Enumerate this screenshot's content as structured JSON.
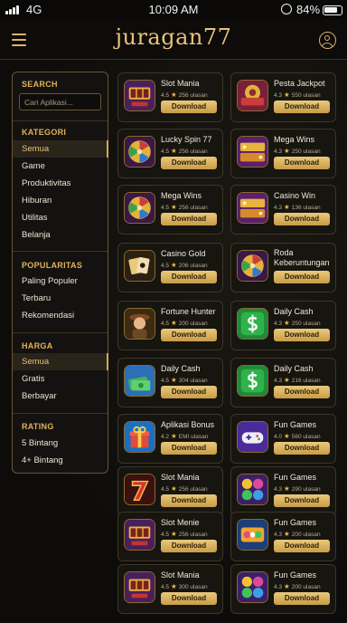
{
  "status_bar": {
    "network": "4G",
    "time": "10:09 AM",
    "battery": "84%"
  },
  "header": {
    "logo": "juragan77"
  },
  "sidebar": {
    "search": {
      "title": "SEARCH",
      "placeholder": "Cari Aplikasi..."
    },
    "kategori": {
      "title": "KATEGORI",
      "items": [
        "Semua",
        "Game",
        "Produktivitas",
        "Hiburan",
        "Utilitas",
        "Belanja"
      ],
      "active": 0
    },
    "popularitas": {
      "title": "POPULARITAS",
      "items": [
        "Paling Populer",
        "Terbaru",
        "Rekomendasi"
      ]
    },
    "harga": {
      "title": "HARGA",
      "items": [
        "Semua",
        "Gratis",
        "Berbayar"
      ],
      "active": 0
    },
    "rating": {
      "title": "RATING",
      "items": [
        "5 Bintang",
        "4+ Bintang"
      ]
    }
  },
  "download_label": "Download",
  "apps": [
    {
      "name": "Slot Mania",
      "rating": "4.5",
      "meta": "256 ulasan",
      "icon": "slot-mania-icon"
    },
    {
      "name": "Pesta Jackpot",
      "rating": "4.3",
      "meta": "550 ulasan",
      "icon": "pesta-jackpot-icon"
    },
    {
      "name": "Lucky Spin 77",
      "rating": "4.5",
      "meta": "256 ulasan",
      "icon": "lucky-spin-wheel-icon"
    },
    {
      "name": "Mega Wins",
      "rating": "4.3",
      "meta": "250 ulasan",
      "icon": "mega-wins-icon"
    },
    {
      "name": "Mega Wins",
      "rating": "4.5",
      "meta": "256 ulasan",
      "icon": "lucky-spin-wheel-icon"
    },
    {
      "name": "Casino Win",
      "rating": "4.3",
      "meta": "136 ulasan",
      "icon": "mega-wins-icon"
    },
    {
      "name": "Casino Gold",
      "rating": "4.5",
      "meta": "206 ulasan",
      "icon": "playing-cards-icon"
    },
    {
      "name": "Roda Keberuntungan",
      "rating": "",
      "meta": "",
      "icon": "lucky-spin-wheel-icon"
    },
    {
      "name": "Fortune Hunter",
      "rating": "4.5",
      "meta": "200 ulasan",
      "icon": "explorer-character-icon"
    },
    {
      "name": "Daily Cash",
      "rating": "4.3",
      "meta": "250 ulasan",
      "icon": "dollar-icon"
    },
    {
      "name": "Daily Cash",
      "rating": "4.5",
      "meta": "304 ulasan",
      "icon": "money-stack-icon"
    },
    {
      "name": "Daily Cash",
      "rating": "4.3",
      "meta": "216 ulasan",
      "icon": "dollar-icon"
    },
    {
      "name": "Aplikasi Bonus",
      "rating": "4.2",
      "meta": "EMI ulasan",
      "icon": "gift-box-icon"
    },
    {
      "name": "Fun Games",
      "rating": "4.0",
      "meta": "560 ulasan",
      "icon": "game-controller-icon"
    },
    {
      "name": "Slot Mania",
      "rating": "4.5",
      "meta": "256 ulasan",
      "icon": "lucky-seven-icon"
    },
    {
      "name": "Fun Games",
      "rating": "4.3",
      "meta": "290 ulasan",
      "icon": "monster-candy-icon"
    },
    {
      "name": "Slot Menie",
      "rating": "4.5",
      "meta": "256 ulasan",
      "icon": "slot-mania-icon"
    },
    {
      "name": "Fun Games",
      "rating": "4.3",
      "meta": "200 ulasan",
      "icon": "candy-bingo-icon"
    },
    {
      "name": "Slot Mania",
      "rating": "4.5",
      "meta": "300 ulasan",
      "icon": "slot-mania-icon"
    },
    {
      "name": "Fun Games",
      "rating": "4.3",
      "meta": "200 ulasan",
      "icon": "monster-candy-icon"
    }
  ],
  "colors": {
    "accent": "#e0b25a",
    "background": "#0d0c0a",
    "button": "#d9b46a"
  }
}
